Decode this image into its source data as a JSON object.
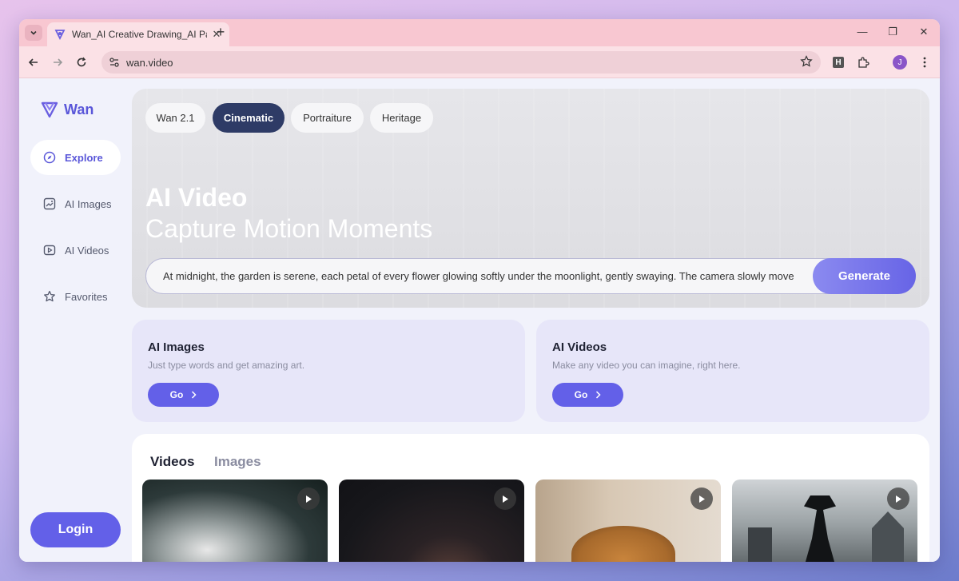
{
  "browser": {
    "tab_title": "Wan_AI Creative Drawing_AI Pa",
    "url": "wan.video",
    "profile_initial": "J",
    "extension_letter": "H"
  },
  "sidebar": {
    "brand": "Wan",
    "items": [
      {
        "label": "Explore",
        "icon": "compass-icon",
        "active": true
      },
      {
        "label": "AI Images",
        "icon": "image-icon",
        "active": false
      },
      {
        "label": "AI Videos",
        "icon": "video-icon",
        "active": false
      },
      {
        "label": "Favorites",
        "icon": "star-icon",
        "active": false
      }
    ],
    "login_label": "Login"
  },
  "hero": {
    "chips": [
      "Wan 2.1",
      "Cinematic",
      "Portraiture",
      "Heritage"
    ],
    "active_chip": "Cinematic",
    "title": "AI Video",
    "subtitle": "Capture Motion Moments",
    "prompt_value": "At midnight, the garden is serene, each petal of every flower glowing softly under the moonlight, gently swaying. The camera slowly move",
    "generate_label": "Generate"
  },
  "cards": [
    {
      "title": "AI Images",
      "description": "Just type words and get amazing art.",
      "button": "Go"
    },
    {
      "title": "AI Videos",
      "description": "Make any video you can imagine, right here.",
      "button": "Go"
    }
  ],
  "gallery": {
    "tabs": [
      "Videos",
      "Images"
    ],
    "active_tab": "Videos"
  },
  "colors": {
    "accent": "#6360e8",
    "brand": "#5a57d9",
    "active_chip": "#2e3b66"
  }
}
